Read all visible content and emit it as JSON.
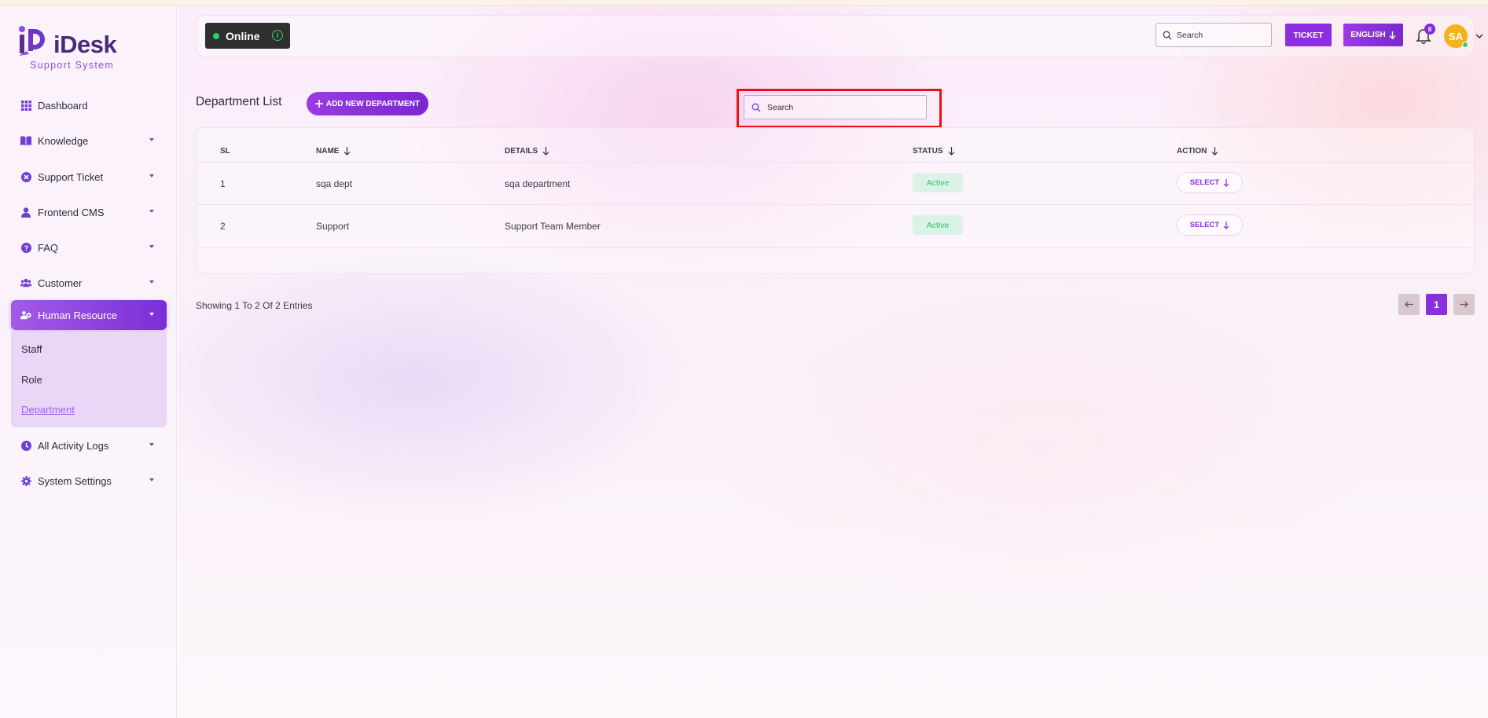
{
  "app": {
    "brand": "iDesk",
    "tagline": "Support System"
  },
  "sidebar": {
    "items": [
      {
        "label": "Dashboard",
        "icon": "grid-icon"
      },
      {
        "label": "Knowledge",
        "icon": "book-icon"
      },
      {
        "label": "Support Ticket",
        "icon": "ticket-x-icon"
      },
      {
        "label": "Frontend CMS",
        "icon": "user-icon"
      },
      {
        "label": "FAQ",
        "icon": "question-circle-icon"
      },
      {
        "label": "Customer",
        "icon": "users-icon"
      },
      {
        "label": "Human Resource",
        "icon": "hr-icon"
      },
      {
        "label": "All Activity Logs",
        "icon": "clock-icon"
      },
      {
        "label": "System Settings",
        "icon": "gear-icon"
      }
    ],
    "submenu": [
      {
        "label": "Staff"
      },
      {
        "label": "Role"
      },
      {
        "label": "Department"
      }
    ]
  },
  "topbar": {
    "status": "Online",
    "search_placeholder": "Search",
    "ticket_label": "TICKET",
    "language_label": "ENGLISH",
    "notification_count": "8",
    "avatar_initials": "SA"
  },
  "page": {
    "title": "Department List",
    "add_button": "ADD NEW DEPARTMENT",
    "search_placeholder": "Search"
  },
  "table": {
    "columns": [
      "SL",
      "NAME",
      "DETAILS",
      "STATUS",
      "ACTION"
    ],
    "rows": [
      {
        "sl": "1",
        "name": "sqa dept",
        "details": "sqa department",
        "status": "Active",
        "action": "SELECT"
      },
      {
        "sl": "2",
        "name": "Support",
        "details": "Support Team Member",
        "status": "Active",
        "action": "SELECT"
      }
    ]
  },
  "footer": {
    "showing": "Showing 1 To 2 Of 2 Entries",
    "current_page": "1"
  },
  "colors": {
    "accent": "#8a2fdc",
    "active_green": "#2bbf6a",
    "highlight": "#ee1111"
  }
}
